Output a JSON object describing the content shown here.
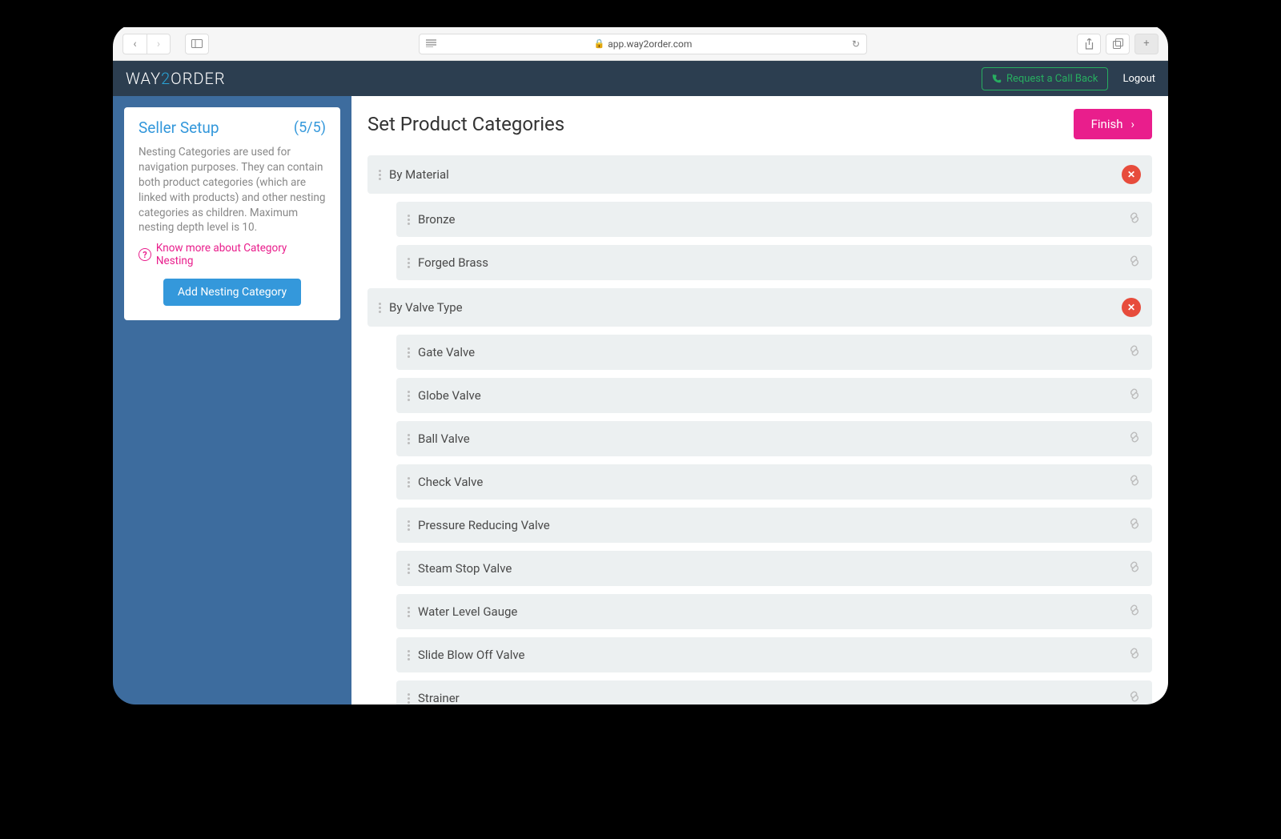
{
  "browser": {
    "url_host": "app.way2order.com"
  },
  "header": {
    "logo_prefix": "WAY",
    "logo_two": "2",
    "logo_suffix": "ORDER",
    "call_back": "Request a Call Back",
    "logout": "Logout"
  },
  "sidebar": {
    "title": "Seller Setup",
    "step": "(5/5)",
    "description": "Nesting Categories are used for navigation purposes. They can contain both product categories (which are linked with products) and other nesting categories as children. Maximum nesting depth level is 10.",
    "know_more": "Know more about Category Nesting",
    "add_button": "Add Nesting Category"
  },
  "main": {
    "title": "Set Product Categories",
    "finish": "Finish"
  },
  "categories": [
    {
      "label": "By Material",
      "level": 0,
      "deletable": true
    },
    {
      "label": "Bronze",
      "level": 1,
      "deletable": false
    },
    {
      "label": "Forged Brass",
      "level": 1,
      "deletable": false
    },
    {
      "label": "By Valve Type",
      "level": 0,
      "deletable": true
    },
    {
      "label": "Gate Valve",
      "level": 1,
      "deletable": false
    },
    {
      "label": "Globe Valve",
      "level": 1,
      "deletable": false
    },
    {
      "label": "Ball Valve",
      "level": 1,
      "deletable": false
    },
    {
      "label": "Check Valve",
      "level": 1,
      "deletable": false
    },
    {
      "label": "Pressure Reducing Valve",
      "level": 1,
      "deletable": false
    },
    {
      "label": "Steam Stop Valve",
      "level": 1,
      "deletable": false
    },
    {
      "label": "Water Level Gauge",
      "level": 1,
      "deletable": false
    },
    {
      "label": "Slide Blow Off Valve",
      "level": 1,
      "deletable": false
    },
    {
      "label": "Strainer",
      "level": 1,
      "deletable": false
    }
  ]
}
